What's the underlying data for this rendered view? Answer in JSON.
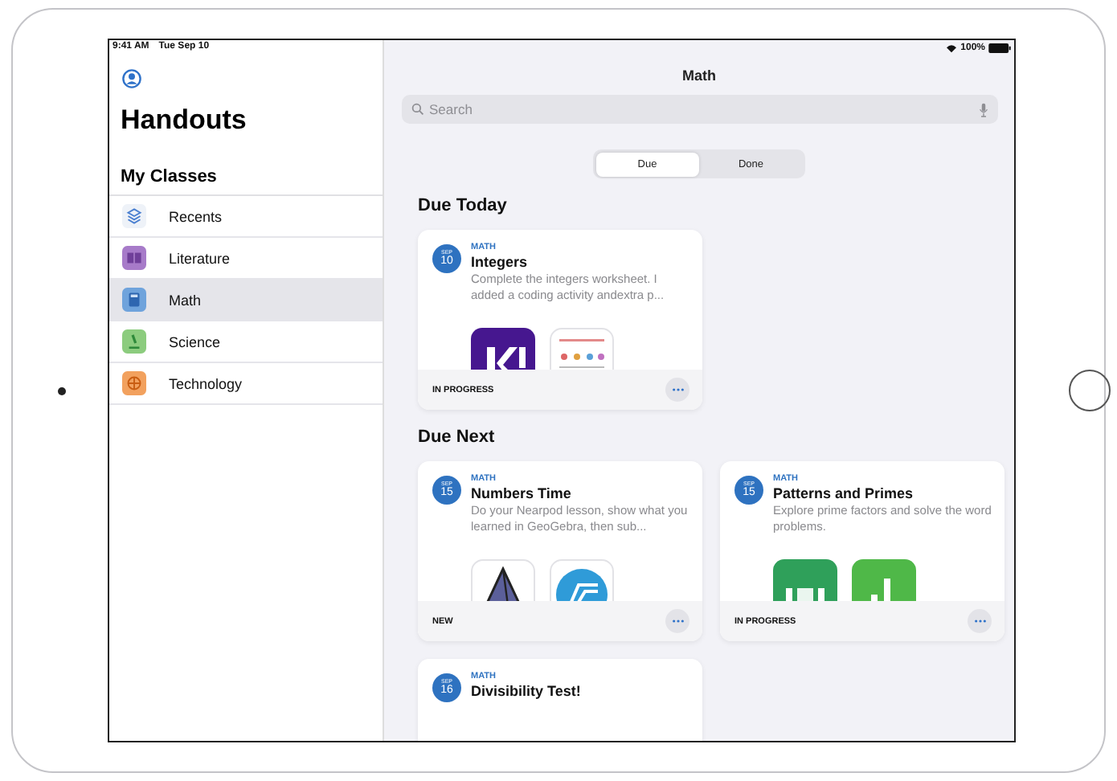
{
  "status_bar": {
    "time": "9:41 AM",
    "date": "Tue Sep 10",
    "battery": "100%"
  },
  "sidebar": {
    "title": "Handouts",
    "section": "My Classes",
    "items": [
      {
        "label": "Recents",
        "kind": "stack",
        "color": "#eef2f8",
        "selected": false
      },
      {
        "label": "Literature",
        "kind": "book",
        "color": "#a77bc9",
        "selected": false
      },
      {
        "label": "Math",
        "kind": "calculator",
        "color": "#6fa3dc",
        "selected": true
      },
      {
        "label": "Science",
        "kind": "microscope",
        "color": "#8ccc7e",
        "selected": false
      },
      {
        "label": "Technology",
        "kind": "globe",
        "color": "#f2a15e",
        "selected": false
      }
    ]
  },
  "main": {
    "title": "Math",
    "search": {
      "placeholder": "Search"
    },
    "segments": [
      {
        "label": "Due",
        "selected": true
      },
      {
        "label": "Done",
        "selected": false
      }
    ],
    "sections": [
      {
        "title": "Due Today",
        "cards": [
          {
            "month": "SEP",
            "day": "10",
            "subject": "MATH",
            "title": "Integers",
            "description": "Complete the integers worksheet. I added a coding activity andextra p...",
            "status": "IN PROGRESS",
            "thumbnails": [
              {
                "kind": "quiz"
              },
              {
                "kind": "document"
              }
            ]
          }
        ]
      },
      {
        "title": "Due Next",
        "cards": [
          {
            "month": "SEP",
            "day": "15",
            "subject": "MATH",
            "title": "Numbers Time",
            "description": "Do your Nearpod lesson, show what you learned in GeoGebra, then sub...",
            "status": "NEW",
            "thumbnails": [
              {
                "kind": "pyramid"
              },
              {
                "kind": "ring"
              }
            ]
          },
          {
            "month": "SEP",
            "day": "15",
            "subject": "MATH",
            "title": "Patterns and Primes",
            "description": "Explore prime factors and solve the word problems.",
            "status": "IN PROGRESS",
            "thumbnails": [
              {
                "kind": "tiles"
              },
              {
                "kind": "bars"
              }
            ]
          },
          {
            "month": "SEP",
            "day": "16",
            "subject": "MATH",
            "title": "Divisibility Test!"
          }
        ]
      }
    ]
  }
}
